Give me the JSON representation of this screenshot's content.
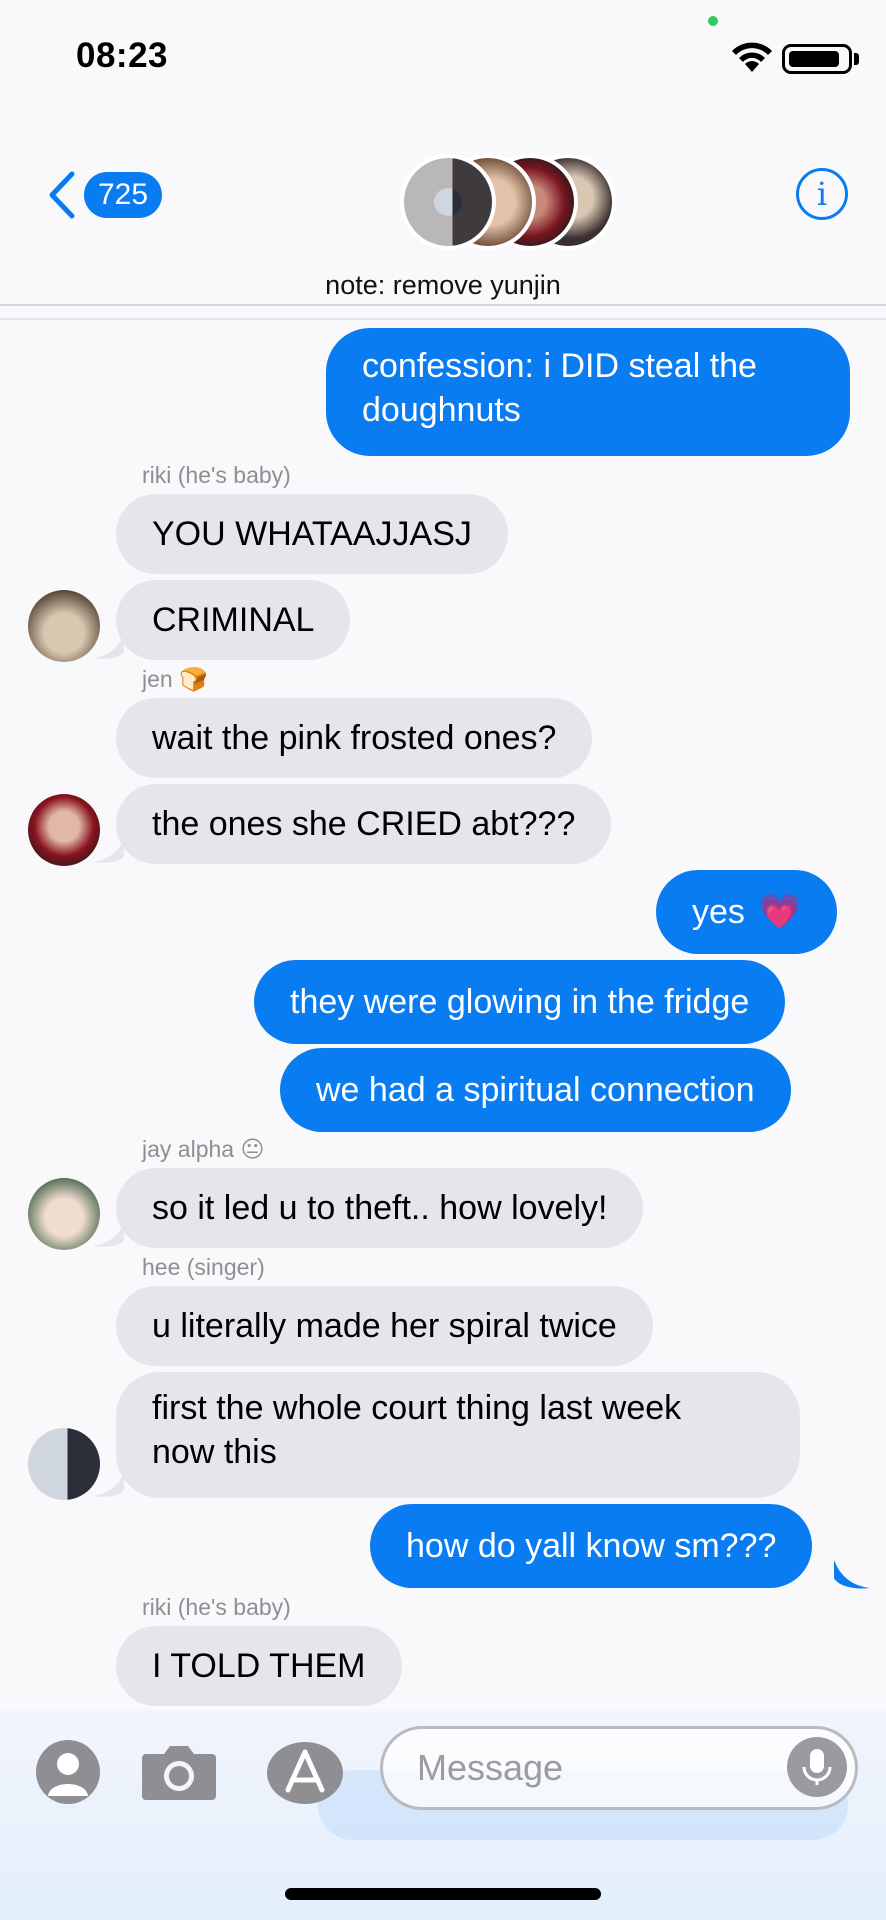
{
  "status_bar": {
    "time": "08:23"
  },
  "header": {
    "unread_count": "725",
    "group_name": "note: remove yunjin",
    "info_label": "i"
  },
  "messages": [
    {
      "direction": "out",
      "text_lines": [
        "confession: i DID steal the",
        "doughnuts"
      ]
    },
    {
      "direction": "in",
      "sender": "riki (he's baby)",
      "text": "YOU WHATAAJJASJ"
    },
    {
      "direction": "in",
      "text": "CRIMINAL"
    },
    {
      "direction": "in",
      "sender": "jen 🍞",
      "text": "wait the pink frosted ones?"
    },
    {
      "direction": "in",
      "text": "the ones she CRIED abt???"
    },
    {
      "direction": "out",
      "text": "yes",
      "emoji": "💗"
    },
    {
      "direction": "out",
      "text": "they were glowing in the fridge"
    },
    {
      "direction": "out",
      "text": "we had a spiritual connection"
    },
    {
      "direction": "in",
      "sender": "jay alpha 😐",
      "text": "so it led u to theft.. how lovely!"
    },
    {
      "direction": "in",
      "sender": "hee (singer)",
      "text": "u literally made her spiral twice"
    },
    {
      "direction": "in",
      "text_lines": [
        "first the whole court thing last week",
        "now this"
      ]
    },
    {
      "direction": "out",
      "text": "how do yall know sm???"
    },
    {
      "direction": "in",
      "sender": "riki (he's baby)",
      "text": "I TOLD THEM"
    }
  ],
  "composer": {
    "placeholder": "Message"
  },
  "icons": {
    "back": "chevron-left-icon",
    "info": "info-icon",
    "contact": "contact-icon",
    "camera": "camera-icon",
    "apps": "app-store-icon",
    "mic": "microphone-icon"
  },
  "colors": {
    "accent": "#0a7cf2",
    "incoming_bubble": "#e6e5eb",
    "background": "#f9f9fb"
  }
}
